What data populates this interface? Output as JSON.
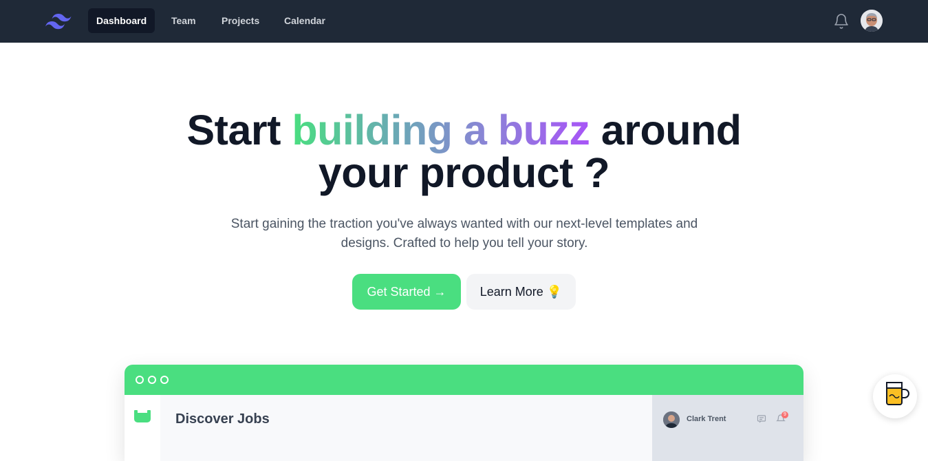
{
  "nav": {
    "links": [
      "Dashboard",
      "Team",
      "Projects",
      "Calendar"
    ],
    "active": "Dashboard",
    "icons": {
      "logo": "tailwind-logo-icon",
      "bell": "bell-icon",
      "avatar": "user-avatar"
    }
  },
  "hero": {
    "title_part1": "Start ",
    "title_highlight": "building a buzz",
    "title_part2": " around",
    "title_line2": "your product ?",
    "subtitle": "Start gaining the traction you've always wanted with our next-level templates and designs. Crafted to help you tell your story.",
    "primary_button": "Get Started →",
    "secondary_button": "Learn More 💡"
  },
  "mockup": {
    "heading": "Discover Jobs",
    "user_name": "Clark Trent",
    "badge_count": "9"
  },
  "colors": {
    "nav_bg": "#1f2937",
    "accent_green": "#4ade80",
    "gradient_end": "#a855f7",
    "text_dark": "#111827"
  }
}
